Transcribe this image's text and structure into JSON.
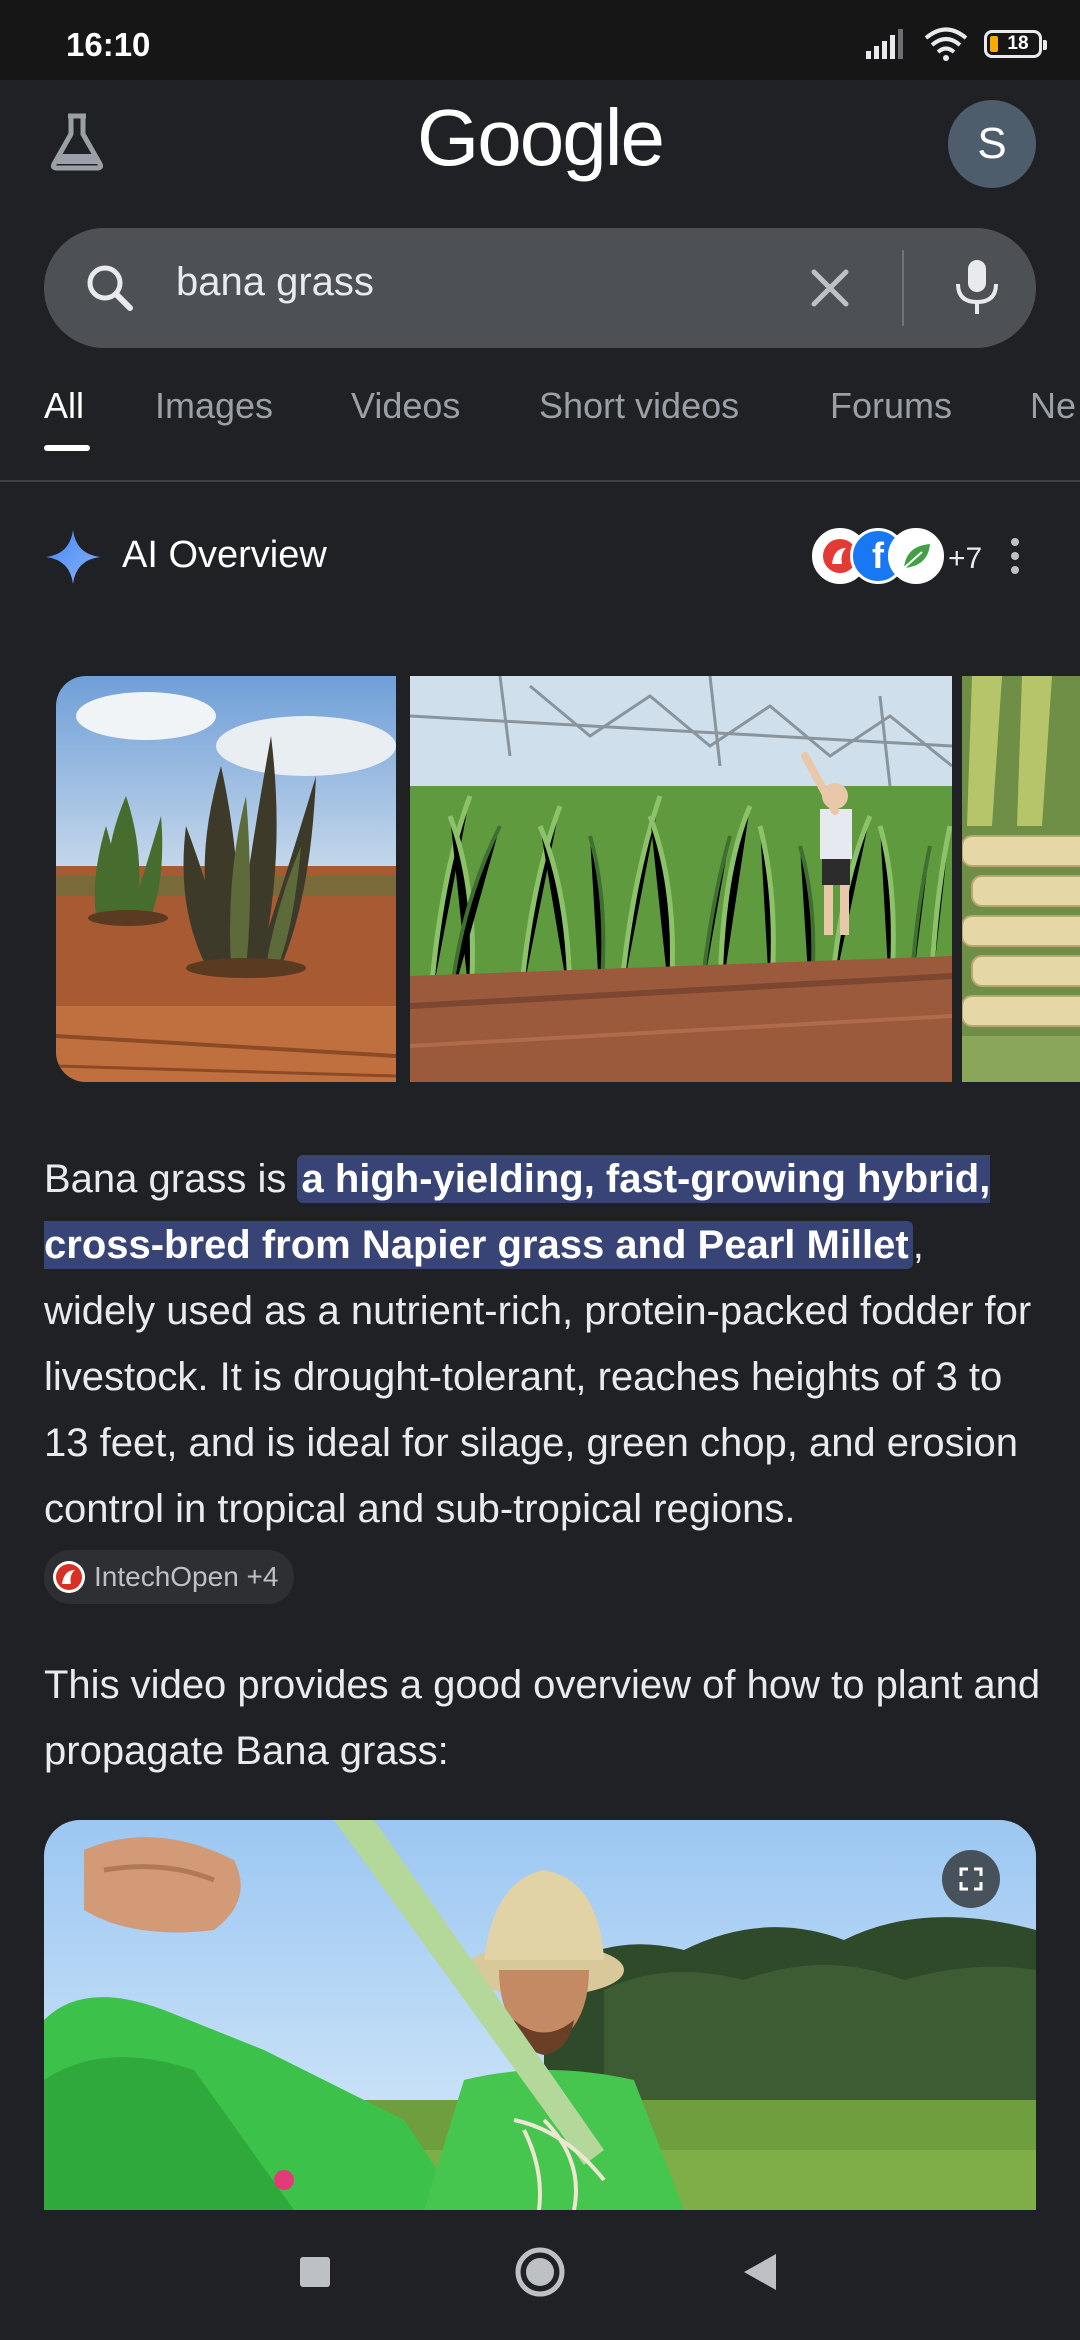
{
  "status_bar": {
    "time": "16:10",
    "battery": "18"
  },
  "header": {
    "logo": "Google",
    "avatar_initial": "S"
  },
  "search": {
    "query": "bana grass"
  },
  "tabs": [
    {
      "label": "All",
      "active": true
    },
    {
      "label": "Images"
    },
    {
      "label": "Videos"
    },
    {
      "label": "Short videos"
    },
    {
      "label": "Forums"
    },
    {
      "label": "Ne"
    }
  ],
  "ai_overview": {
    "title": "AI Overview",
    "sources_more": "+7",
    "source_icons": [
      "intechopen-icon",
      "facebook-icon",
      "leaf-icon"
    ],
    "images": [
      "bana-grass-plants-field",
      "tall-grass-man-irrigation",
      "cut-grass-stalks"
    ],
    "answer": {
      "prefix": "Bana grass is ",
      "highlight": "a high-yielding, fast-growing hybrid, cross-bred from Napier grass and Pearl Millet",
      "rest": ", widely used as a nutrient-rich, protein-packed fodder for livestock. It is drought-tolerant, reaches heights of 3 to 13 feet, and is ideal for silage, green chop, and erosion control in tropical and sub-tropical regions.",
      "citation": "IntechOpen +4"
    },
    "video_intro": "This video provides a good overview of how to plant and propagate Bana grass:"
  },
  "colors": {
    "background": "#202124",
    "highlight": "#394476",
    "search_bg": "#4d5156"
  }
}
